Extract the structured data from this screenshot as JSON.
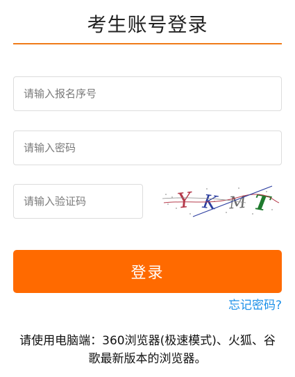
{
  "page": {
    "title": "考生账号登录"
  },
  "form": {
    "id_placeholder": "请输入报名序号",
    "password_placeholder": "请输入密码",
    "captcha_placeholder": "请输入验证码",
    "captcha_text": "YKMT",
    "login_label": "登录",
    "forgot_label": "忘记密码?"
  },
  "notice": {
    "text": "请使用电脑端：360浏览器(极速模式)、火狐、谷歌最新版本的浏览器。"
  },
  "colors": {
    "accent": "#ff6a00",
    "link": "#1a8fe8"
  }
}
